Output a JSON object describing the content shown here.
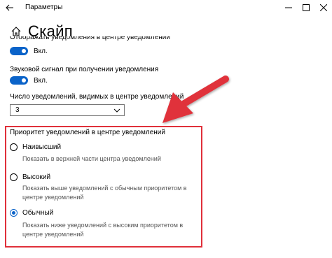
{
  "window": {
    "title": "Параметры"
  },
  "header": {
    "page_title": "Скайп"
  },
  "settings": {
    "cut_off_label": "Отображать уведомления в центре уведомлений",
    "toggle1_state": "Вкл.",
    "sound_label": "Звуковой сигнал при получении уведомления",
    "toggle2_state": "Вкл.",
    "count_label": "Число уведомлений, видимых в центре уведомлений",
    "count_value": "3"
  },
  "priority": {
    "title": "Приоритет уведомлений в центре уведомлений",
    "options": [
      {
        "label": "Наивысший",
        "description": "Показать в верхней части центра уведомлений",
        "checked": false
      },
      {
        "label": "Высокий",
        "description": "Показать выше уведомлений с обычным приоритетом в центре уведомлений",
        "checked": false
      },
      {
        "label": "Обычный",
        "description": "Показать ниже уведомлений с высоким приоритетом в центре уведомлений",
        "checked": true
      }
    ]
  },
  "colors": {
    "accent": "#0a63c9",
    "highlight": "#e0303a"
  },
  "icons": {
    "back": "arrow-left-icon",
    "home": "home-icon",
    "dropdown": "chevron-down-icon"
  }
}
